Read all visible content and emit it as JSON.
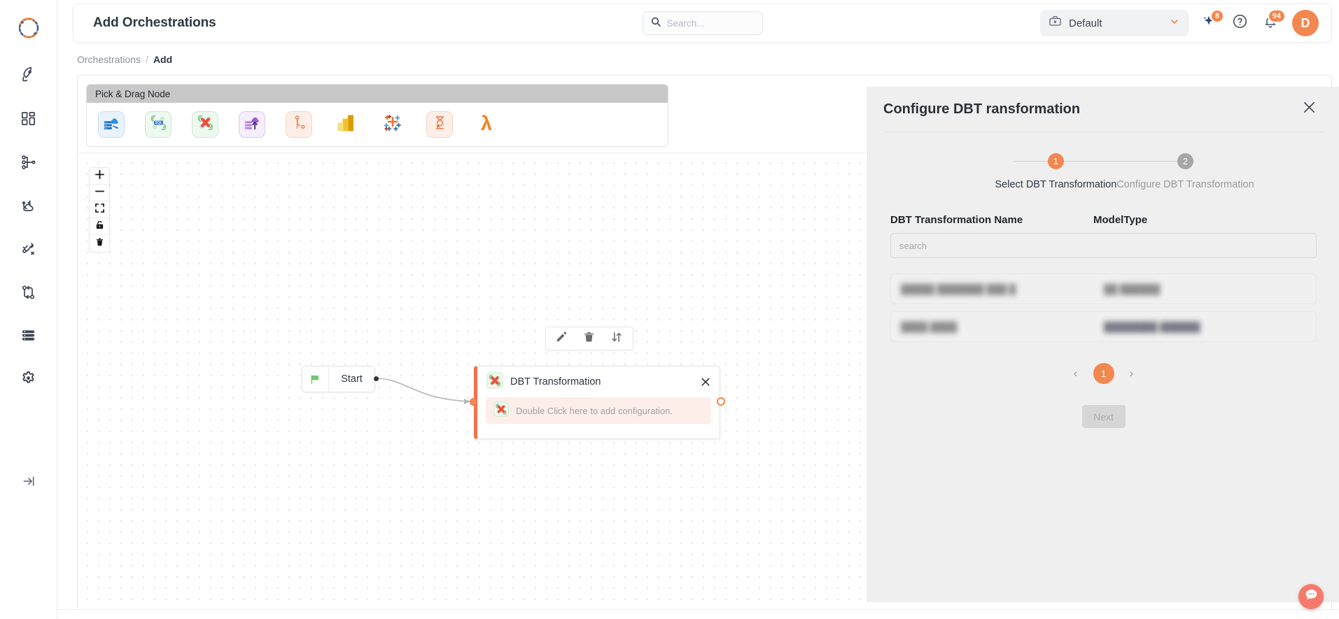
{
  "header": {
    "page_title": "Add Orchestrations",
    "search": {
      "value": "",
      "placeholder": "Search..."
    },
    "workspace": {
      "label": "Default",
      "icon": "briefcase-icon",
      "chevron": "chevron-down-icon"
    },
    "ai_sparkle": {
      "icon": "sparkle-icon",
      "badge": "8"
    },
    "help": {
      "icon": "help-circle-icon"
    },
    "notifications": {
      "icon": "bell-icon",
      "badge": "94"
    },
    "avatar": {
      "initial": "D",
      "color": "#f2874f"
    }
  },
  "breadcrumb": {
    "root": "Orchestrations",
    "separator": "/",
    "current": "Add"
  },
  "sidebar": {
    "logo": "app-logo",
    "items": [
      {
        "name": "rocket",
        "icon": "rocket-icon"
      },
      {
        "name": "dashboard",
        "icon": "grid-squares-icon"
      },
      {
        "name": "pipelines",
        "icon": "nodes-tree-icon"
      },
      {
        "name": "sync",
        "icon": "cloud-sync-icon"
      },
      {
        "name": "routes",
        "icon": "route-path-icon"
      },
      {
        "name": "orchestrations",
        "icon": "flow-loop-icon"
      },
      {
        "name": "datasets",
        "icon": "server-stack-icon"
      },
      {
        "name": "settings",
        "icon": "gear-icon"
      }
    ],
    "collapse": {
      "icon": "collapse-arrow-icon"
    }
  },
  "palette": {
    "title": "Pick & Drag Node",
    "nodes": [
      {
        "name": "data-lake-ingest",
        "icon": "database-cloud-icon",
        "chip": "chip-blue"
      },
      {
        "name": "sql-transform",
        "icon": "sql-badge-icon",
        "chip": "chip-green"
      },
      {
        "name": "dbt-transformation",
        "icon": "dbt-logo-icon",
        "chip": "chip-green"
      },
      {
        "name": "cloud-upload",
        "icon": "database-upload-icon",
        "chip": "chip-purple"
      },
      {
        "name": "airflow",
        "icon": "airflow-icon",
        "chip": "chip-peach"
      },
      {
        "name": "power-bi",
        "icon": "power-bi-icon",
        "chip": "chip-plain"
      },
      {
        "name": "tableau",
        "icon": "tableau-icon",
        "chip": "chip-plain"
      },
      {
        "name": "informatica",
        "icon": "hourglass-icon",
        "chip": "chip-peach"
      },
      {
        "name": "aws-lambda",
        "icon": "lambda-icon",
        "chip": "chip-plain"
      }
    ]
  },
  "canvas": {
    "controls": [
      {
        "name": "zoom-in",
        "icon": "plus-icon",
        "glyph": "+"
      },
      {
        "name": "zoom-out",
        "icon": "minus-icon",
        "glyph": "−"
      },
      {
        "name": "fit-view",
        "icon": "fit-view-icon",
        "glyph": ""
      },
      {
        "name": "lock",
        "icon": "lock-icon",
        "glyph": ""
      },
      {
        "name": "delete-all",
        "icon": "trash-icon",
        "glyph": ""
      }
    ],
    "node_toolbar": [
      {
        "name": "edit",
        "icon": "pencil-icon"
      },
      {
        "name": "delete",
        "icon": "trash-icon"
      },
      {
        "name": "reorder",
        "icon": "swap-arrows-icon"
      }
    ],
    "start_node": {
      "label": "Start",
      "icon": "green-flag-icon"
    },
    "dbt_node": {
      "title": "DBT Transformation",
      "icon": "dbt-logo-icon",
      "close_icon": "close-icon",
      "config_placeholder": "Double Click here to add configuration.",
      "accent": "#f2724b"
    }
  },
  "panel": {
    "title": "Configure DBT ransformation",
    "close_icon": "close-icon",
    "steps": [
      {
        "num": "1",
        "label": "Select DBT Transformation",
        "state": "active"
      },
      {
        "num": "2",
        "label": "Configure DBT Transformation",
        "state": "inactive"
      }
    ],
    "columns": {
      "name": "DBT Transformation Name",
      "type": "ModelType"
    },
    "search": {
      "value": "",
      "placeholder": "search"
    },
    "rows": [
      {
        "name": "█████ ███████ ███ █",
        "type": "██ ██████"
      },
      {
        "name": "████ ████",
        "type": "████████ ██████"
      }
    ],
    "pagination": {
      "prev": "‹",
      "page": "1",
      "next": "›"
    },
    "next_button": "Next"
  },
  "chat": {
    "icon": "chat-bubble-icon"
  }
}
